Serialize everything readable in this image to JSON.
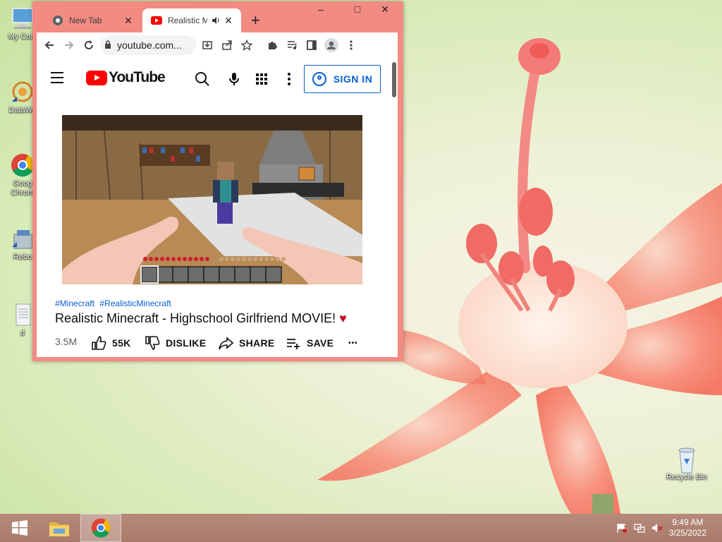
{
  "desktop": {
    "icons": [
      {
        "label": "My Com",
        "icon": "computer-icon"
      },
      {
        "label": "DataWa",
        "icon": "datawave-icon"
      },
      {
        "label": "Goog\nChrom",
        "icon": "chrome-icon"
      },
      {
        "label": "Rebo",
        "icon": "reboot-icon"
      },
      {
        "label": "d",
        "icon": "text-file-icon"
      }
    ],
    "recycle_bin": {
      "label": "Recycle Bin",
      "icon": "recycle-bin-icon"
    }
  },
  "browser": {
    "tabs": [
      {
        "title": "New Tab",
        "icon": "chrome-icon",
        "active": false
      },
      {
        "title": "Realistic M",
        "icon": "youtube-icon",
        "active": true,
        "audio": "speaker-icon"
      }
    ],
    "new_tab_symbol": "+",
    "window_controls": {
      "minimize": "–",
      "maximize": "□",
      "close": "✕"
    },
    "address": "youtube.com...",
    "toolbar_icons": [
      "back-icon",
      "forward-icon",
      "reload-icon",
      "lock-icon",
      "install-icon",
      "share-icon",
      "star-icon",
      "extensions-icon",
      "media-icon",
      "sidepanel-icon",
      "profile-icon",
      "menu-icon"
    ]
  },
  "youtube": {
    "logo_text": "YouTube",
    "sign_in_label": "SIGN IN",
    "hashtags": [
      "#Minecraft",
      "#RealisticMinecraft"
    ],
    "video_title": "Realistic Minecraft - Highschool Girlfriend MOVIE!",
    "title_emoji": "♥",
    "views": "3.5M",
    "likes": "55K",
    "dislike_label": "DISLIKE",
    "share_label": "SHARE",
    "save_label": "SAVE",
    "more_label": "•••"
  },
  "taskbar": {
    "time": "9:49 AM",
    "date": "3/25/2022",
    "apps": [
      "windows-start-icon",
      "file-explorer-icon",
      "chrome-icon"
    ],
    "tray_icons": [
      "action-center-flag-icon",
      "network-icon",
      "volume-muted-icon"
    ]
  },
  "colors": {
    "chrome_frame": "#f28b82",
    "youtube_red": "#ff0000",
    "link_blue": "#065fd4",
    "taskbar": "#ad7f6f"
  }
}
